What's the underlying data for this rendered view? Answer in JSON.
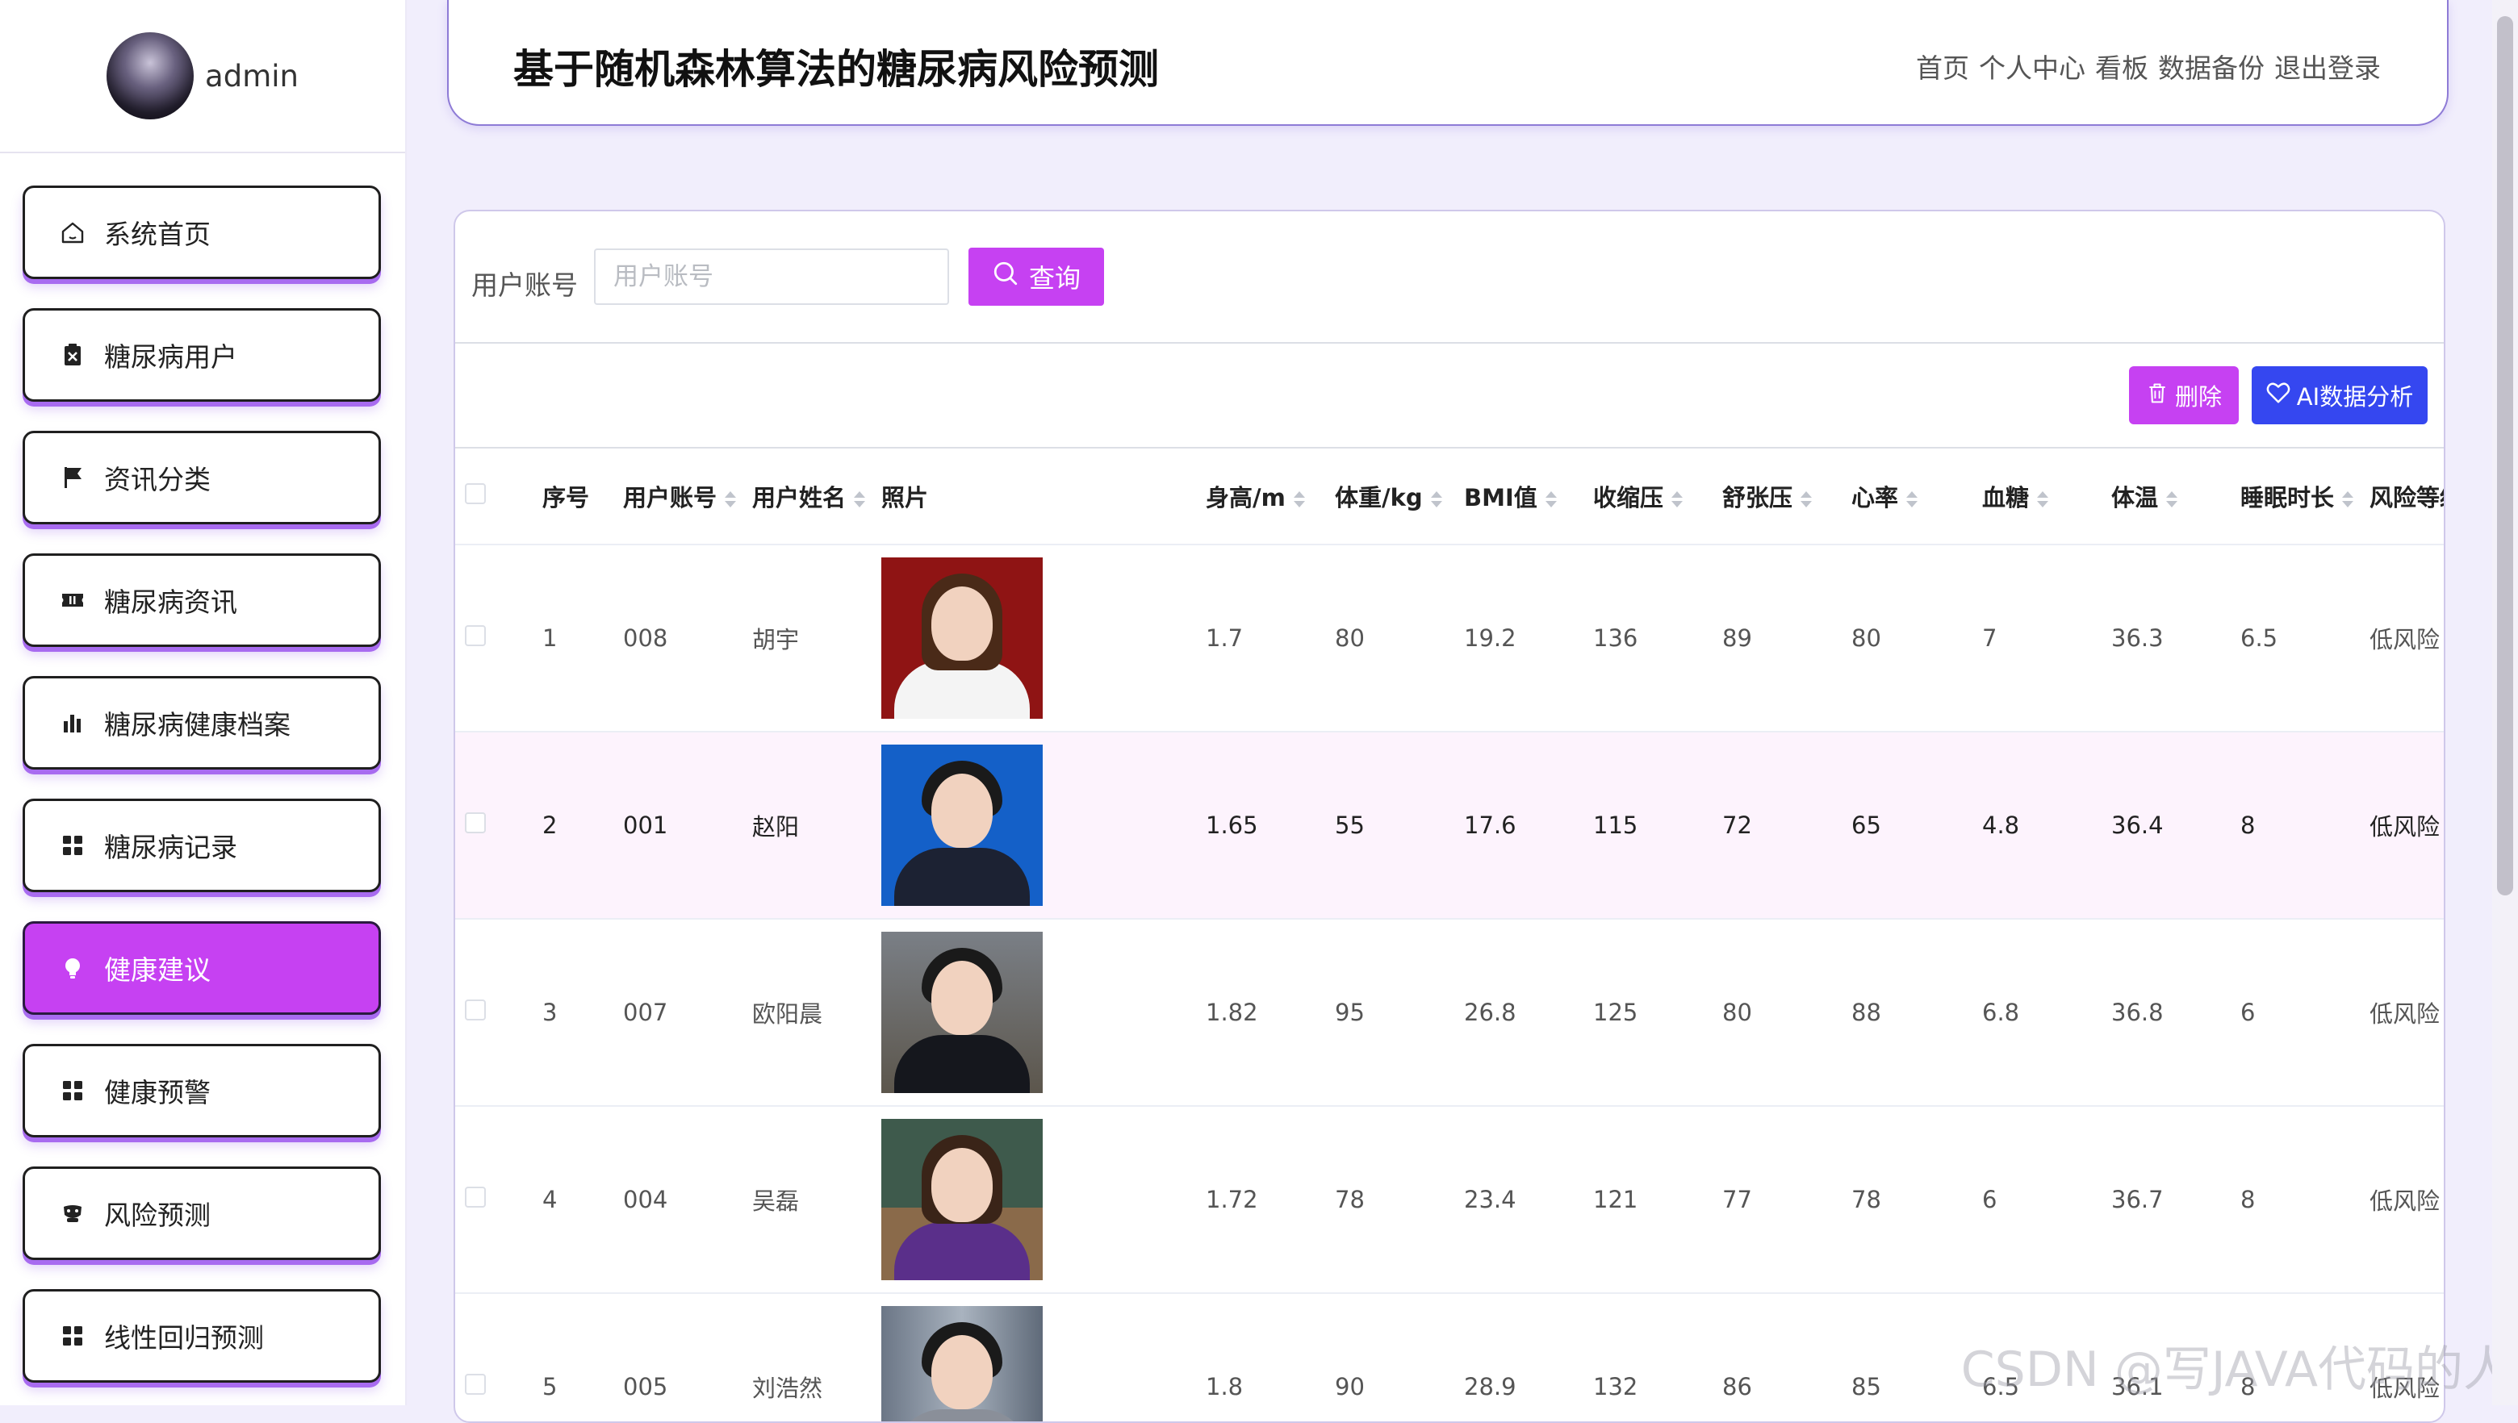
{
  "user": {
    "name": "admin"
  },
  "header": {
    "title": "基于随机森林算法的糖尿病风险预测",
    "nav": [
      "首页",
      "个人中心",
      "看板",
      "数据备份",
      "退出登录"
    ]
  },
  "sidebar": {
    "items": [
      {
        "label": "系统首页",
        "icon": "home-icon"
      },
      {
        "label": "糖尿病用户",
        "icon": "clipboard-icon"
      },
      {
        "label": "资讯分类",
        "icon": "flag-icon"
      },
      {
        "label": "糖尿病资讯",
        "icon": "ticket-icon"
      },
      {
        "label": "糖尿病健康档案",
        "icon": "bar-chart-icon"
      },
      {
        "label": "糖尿病记录",
        "icon": "grid-icon"
      },
      {
        "label": "健康建议",
        "icon": "bulb-icon",
        "active": true
      },
      {
        "label": "健康预警",
        "icon": "grid-icon"
      },
      {
        "label": "风险预测",
        "icon": "mask-icon"
      },
      {
        "label": "线性回归预测",
        "icon": "grid-icon"
      }
    ]
  },
  "search": {
    "label": "用户账号",
    "placeholder": "用户账号",
    "button": "查询"
  },
  "actions": {
    "delete": "删除",
    "ai": "AI数据分析"
  },
  "table": {
    "columns": [
      "序号",
      "用户账号",
      "用户姓名",
      "照片",
      "身高/m",
      "体重/kg",
      "BMI值",
      "收缩压",
      "舒张压",
      "心率",
      "血糖",
      "体温",
      "睡眠时长",
      "风险等级"
    ],
    "rows": [
      {
        "seq": "1",
        "account": "008",
        "name": "胡宇",
        "height": "1.7",
        "weight": "80",
        "bmi": "19.2",
        "sbp": "136",
        "dbp": "89",
        "hr": "80",
        "glucose": "7",
        "temp": "36.3",
        "sleep": "6.5",
        "risk": "低风险"
      },
      {
        "seq": "2",
        "account": "001",
        "name": "赵阳",
        "height": "1.65",
        "weight": "55",
        "bmi": "17.6",
        "sbp": "115",
        "dbp": "72",
        "hr": "65",
        "glucose": "4.8",
        "temp": "36.4",
        "sleep": "8",
        "risk": "低风险"
      },
      {
        "seq": "3",
        "account": "007",
        "name": "欧阳晨",
        "height": "1.82",
        "weight": "95",
        "bmi": "26.8",
        "sbp": "125",
        "dbp": "80",
        "hr": "88",
        "glucose": "6.8",
        "temp": "36.8",
        "sleep": "6",
        "risk": "低风险"
      },
      {
        "seq": "4",
        "account": "004",
        "name": "吴磊",
        "height": "1.72",
        "weight": "78",
        "bmi": "23.4",
        "sbp": "121",
        "dbp": "77",
        "hr": "78",
        "glucose": "6",
        "temp": "36.7",
        "sleep": "8",
        "risk": "低风险"
      },
      {
        "seq": "5",
        "account": "005",
        "name": "刘浩然",
        "height": "1.8",
        "weight": "90",
        "bmi": "28.9",
        "sbp": "132",
        "dbp": "86",
        "hr": "85",
        "glucose": "6.5",
        "temp": "36.1",
        "sleep": "8",
        "risk": "低风险"
      }
    ]
  },
  "colors": {
    "accent": "#c641f2",
    "ai_button": "#3547f0",
    "page_bg": "#f1eefc"
  },
  "watermark": "CSDN @写JAVA代码的人"
}
